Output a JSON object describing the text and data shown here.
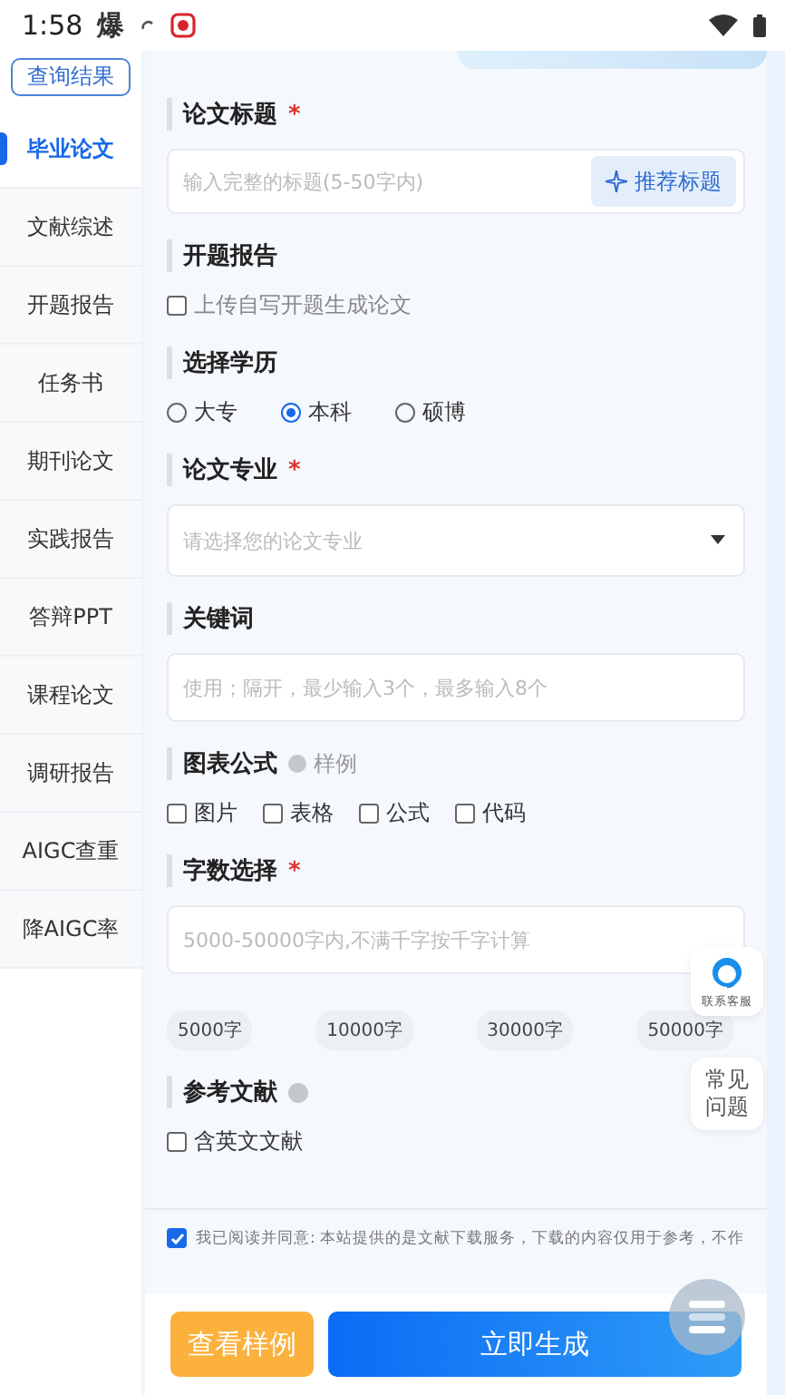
{
  "status_bar": {
    "time": "1:58",
    "notification": "爆"
  },
  "sidebar": {
    "query_button": "查询结果",
    "items": [
      {
        "label": "毕业论文",
        "selected": true
      },
      {
        "label": "文献综述",
        "selected": false
      },
      {
        "label": "开题报告",
        "selected": false
      },
      {
        "label": "任务书",
        "selected": false
      },
      {
        "label": "期刊论文",
        "selected": false
      },
      {
        "label": "实践报告",
        "selected": false
      },
      {
        "label": "答辩PPT",
        "selected": false
      },
      {
        "label": "课程论文",
        "selected": false
      },
      {
        "label": "调研报告",
        "selected": false
      },
      {
        "label": "AIGC查重",
        "selected": false
      },
      {
        "label": "降AIGC率",
        "selected": false
      }
    ]
  },
  "sections": [
    {
      "kind": "input",
      "label": "论文标题",
      "required_mark": "*",
      "placeholder": "输入完整的标题(5-50字内)",
      "action": "推荐标题"
    },
    {
      "kind": "checkboxes",
      "label": "开题报告",
      "options": [
        {
          "label": "上传自写开题生成论文",
          "checked": false
        }
      ]
    },
    {
      "kind": "radios",
      "label": "选择学历",
      "options": [
        {
          "label": "大专",
          "selected": false
        },
        {
          "label": "本科",
          "selected": true
        },
        {
          "label": "硕博",
          "selected": false
        }
      ]
    },
    {
      "kind": "select",
      "label": "论文专业",
      "required_mark": "*",
      "placeholder": "请选择您的论文专业"
    },
    {
      "kind": "input",
      "label": "关键词",
      "placeholder": "使用；隔开，最少输入3个，最多输入8个"
    },
    {
      "kind": "checkboxes",
      "label": "图表公式",
      "hint": "样例",
      "options": [
        {
          "label": "图片",
          "checked": false
        },
        {
          "label": "表格",
          "checked": false
        },
        {
          "label": "公式",
          "checked": false
        },
        {
          "label": "代码",
          "checked": false
        }
      ]
    },
    {
      "kind": "input",
      "label": "字数选择",
      "required_mark": "*",
      "placeholder": "5000-50000字内,不满千字按千字计算",
      "chips": [
        "5000字",
        "10000字",
        "30000字",
        "50000字"
      ]
    },
    {
      "kind": "checkboxes",
      "label": "参考文献",
      "help": true,
      "options": [
        {
          "label": "含英文文献",
          "checked": false
        }
      ]
    }
  ],
  "agreement": {
    "checked": true,
    "text": "我已阅读并同意: 本站提供的是文献下载服务，下载的内容仅用于参考，不作"
  },
  "buttons": [
    {
      "label": "查看样例",
      "kind": "secondary"
    },
    {
      "label": "立即生成",
      "kind": "primary"
    }
  ],
  "floating": {
    "service": "联系客服",
    "faq": "常见问题"
  }
}
